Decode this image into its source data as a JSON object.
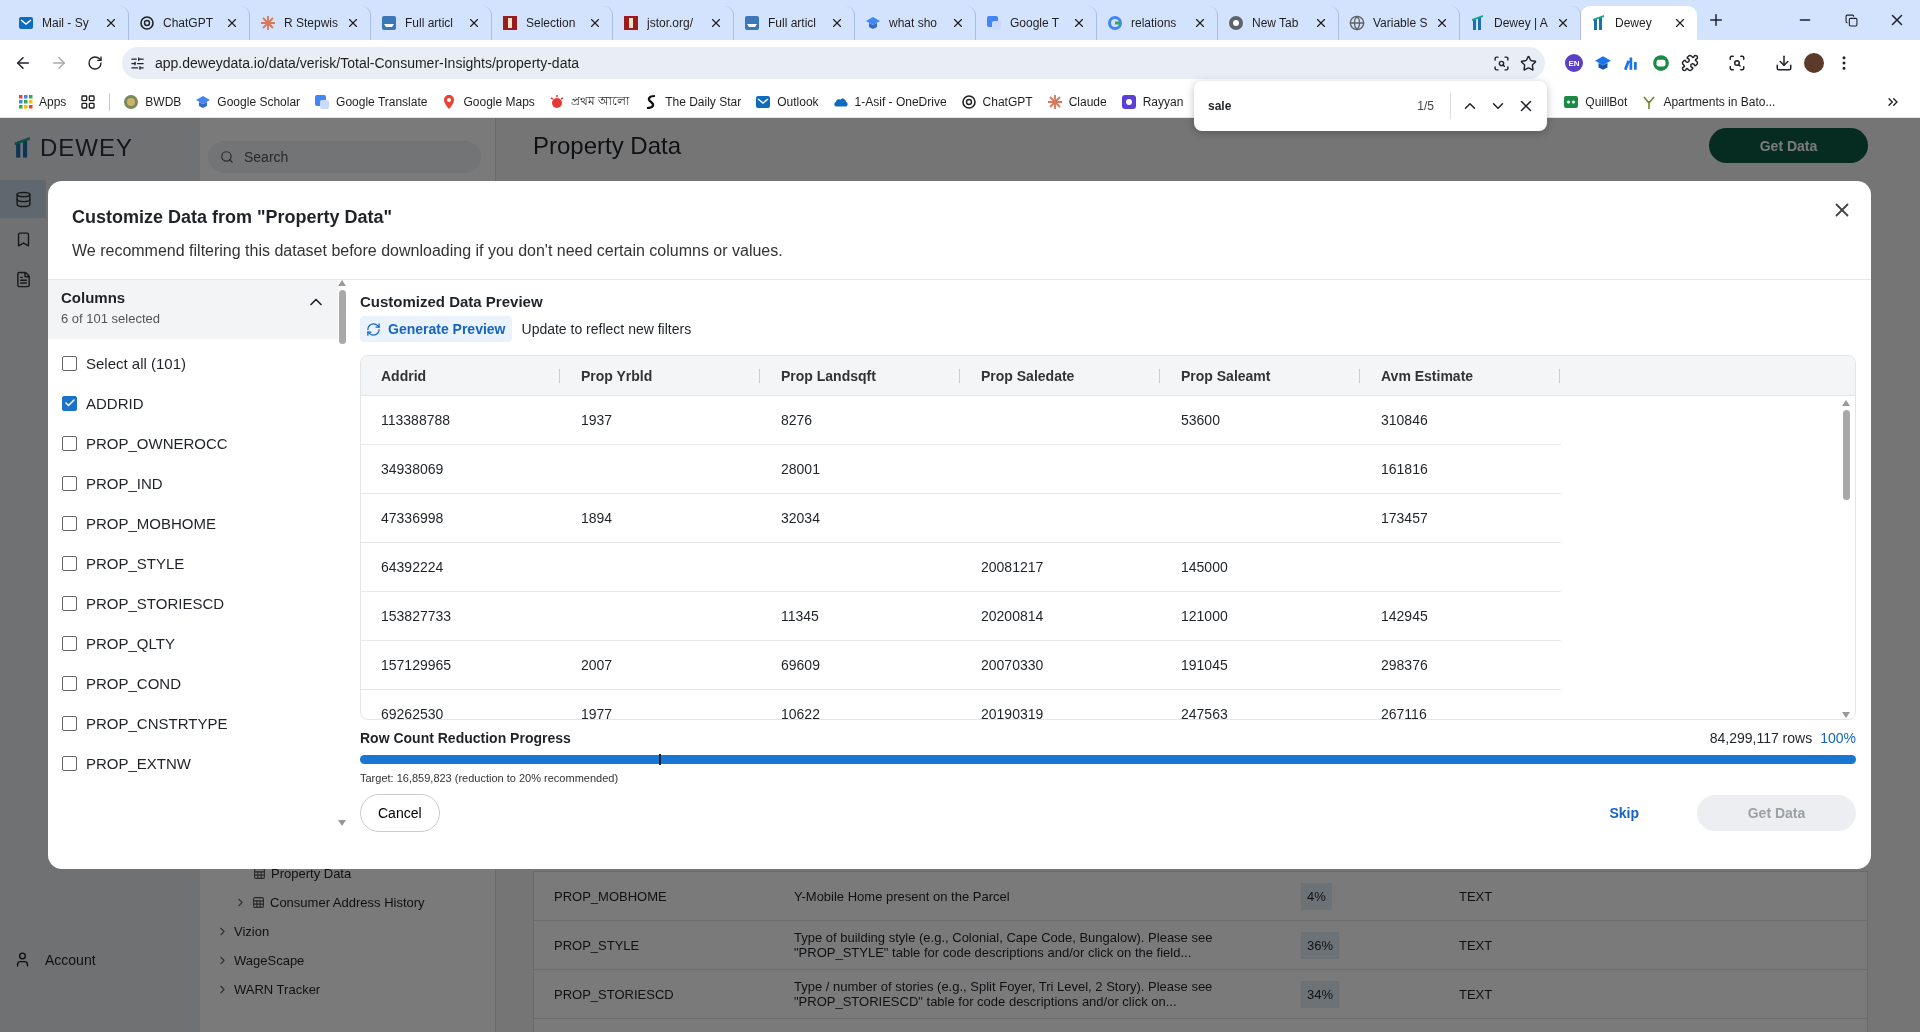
{
  "browser": {
    "tabs": [
      {
        "title": "Mail - Sy",
        "selected": false
      },
      {
        "title": "ChatGPT",
        "selected": false
      },
      {
        "title": "R Stepwis",
        "selected": false
      },
      {
        "title": "Full articl",
        "selected": false
      },
      {
        "title": "Selection",
        "selected": false
      },
      {
        "title": "jstor.org/",
        "selected": false
      },
      {
        "title": "Full articl",
        "selected": false
      },
      {
        "title": "what sho",
        "selected": false
      },
      {
        "title": "Google T",
        "selected": false
      },
      {
        "title": "relations",
        "selected": false
      },
      {
        "title": "New Tab",
        "selected": false
      },
      {
        "title": "Variable S",
        "selected": false
      },
      {
        "title": "Dewey | A",
        "selected": false
      },
      {
        "title": "Dewey",
        "selected": true
      }
    ],
    "url": "app.deweydata.io/data/verisk/Total-Consumer-Insights/property-data",
    "profile_badge": "EN",
    "apps_label": "Apps",
    "bookmarks": [
      "BWDB",
      "Google Scholar",
      "Google Translate",
      "Google Maps",
      "প্রথম আলো",
      "The Daily Star",
      "Outlook",
      "1-Asif - OneDrive",
      "ChatGPT",
      "Claude",
      "Rayyan"
    ],
    "bookmarks_after_find": [
      "QuillBot",
      "Apartments in Bato..."
    ],
    "find_bar": {
      "query": "sale",
      "count": "1/5"
    }
  },
  "app": {
    "logo": "DEWEY",
    "search": {
      "placeholder": "Search"
    },
    "page_title": "Property Data",
    "get_data_button": "Get Data",
    "rail": [
      {
        "selected": true
      },
      {
        "selected": false
      },
      {
        "selected": false
      }
    ],
    "account": "Account",
    "nav_tree": [
      {
        "children": [
          {
            "label": "Property Data"
          },
          {
            "label": "Consumer Address History",
            "expanded": false
          }
        ]
      },
      {
        "label": "Vizion",
        "expanded": false
      },
      {
        "label": "WageScape",
        "expanded": false
      },
      {
        "label": "WARN Tracker",
        "expanded": false
      }
    ],
    "fields": [
      {
        "name": "PROP_MOBHOME",
        "description": "Y-Mobile Home present on the Parcel",
        "fill_rate": "4%",
        "type": "TEXT"
      },
      {
        "name": "PROP_STYLE",
        "description": "Type of building style (e.g., Colonial, Cape Code, Bungalow). Please see \"PROP_STYLE\" table for code descriptions and/or click on the field...",
        "fill_rate": "36%",
        "type": "TEXT"
      },
      {
        "name": "PROP_STORIESCD",
        "description": "Type / number of stories (e.g., Split Foyer, Tri Level, 2 Story). Please see \"PROP_STORIESCD\" table for code descriptions and/or click on...",
        "fill_rate": "34%",
        "type": "TEXT"
      }
    ]
  },
  "modal": {
    "title": "Customize Data from \"Property Data\"",
    "subtitle": "We recommend filtering this dataset before downloading if you don't need certain columns or values.",
    "columns_panel": {
      "title": "Columns",
      "count": "6 of 101 selected",
      "expanded": true,
      "items": [
        {
          "label": "Select all (101)",
          "checked": false
        },
        {
          "label": "ADDRID",
          "checked": true
        },
        {
          "label": "PROP_OWNEROCC",
          "checked": false
        },
        {
          "label": "PROP_IND",
          "checked": false
        },
        {
          "label": "PROP_MOBHOME",
          "checked": false
        },
        {
          "label": "PROP_STYLE",
          "checked": false
        },
        {
          "label": "PROP_STORIESCD",
          "checked": false
        },
        {
          "label": "PROP_QLTY",
          "checked": false
        },
        {
          "label": "PROP_COND",
          "checked": false
        },
        {
          "label": "PROP_CNSTRTYPE",
          "checked": false
        },
        {
          "label": "PROP_EXTNW",
          "checked": false
        }
      ]
    },
    "preview": {
      "title": "Customized Data Preview",
      "generate_button": "Generate Preview",
      "hint": "Update to reflect new filters",
      "columns": [
        "Addrid",
        "Prop Yrbld",
        "Prop Landsqft",
        "Prop Saledate",
        "Prop Saleamt",
        "Avm Estimate"
      ],
      "rows": [
        [
          "113388788",
          "1937",
          "8276",
          null,
          "53600",
          "310846"
        ],
        [
          "34938069",
          null,
          "28001",
          null,
          null,
          "161816"
        ],
        [
          "47336998",
          "1894",
          "32034",
          null,
          null,
          "173457"
        ],
        [
          "64392224",
          null,
          null,
          "20081217",
          "145000",
          null
        ],
        [
          "153827733",
          null,
          "11345",
          "20200814",
          "121000",
          "142945"
        ],
        [
          "157129965",
          "2007",
          "69609",
          "20070330",
          "191045",
          "298376"
        ],
        [
          "69262530",
          "1977",
          "10622",
          "20190319",
          "247563",
          "267116"
        ]
      ]
    },
    "progress": {
      "title": "Row Count Reduction Progress",
      "rows": "84,299,117 rows",
      "percent": "100%",
      "level": 1,
      "marker": {
        "level": 0.2
      },
      "target": "Target: 16,859,823 (reduction to 20% recommended)"
    },
    "buttons": {
      "cancel": "Cancel",
      "skip": "Skip",
      "get_data": {
        "label": "Get Data",
        "disabled": true
      }
    }
  }
}
